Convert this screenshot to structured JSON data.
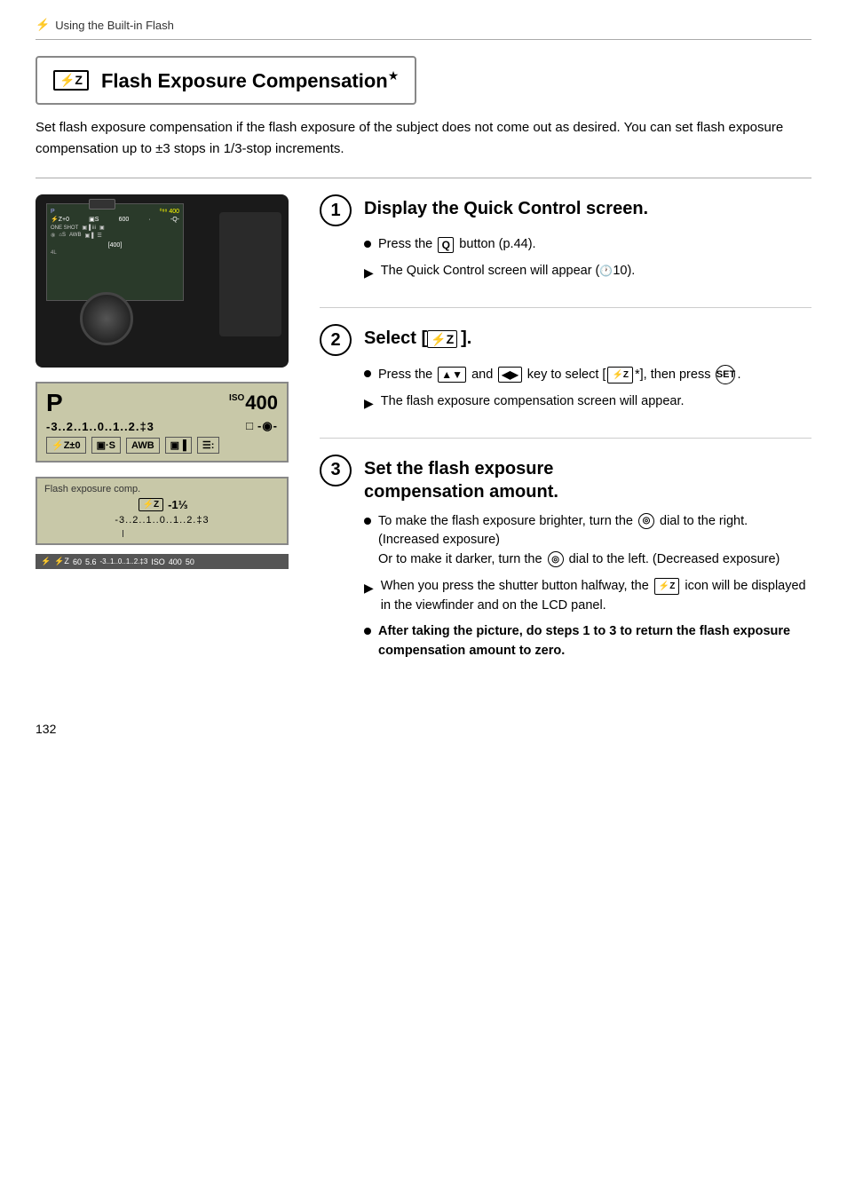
{
  "header": {
    "flash_icon": "⚡",
    "label": "Using the Built-in Flash"
  },
  "section": {
    "icon_label": "⚡Z",
    "title": "Flash Exposure Compensation",
    "star": "★",
    "intro": "Set flash exposure compensation if the flash exposure of the subject does not come out as desired. You can set flash exposure compensation up to ±3 stops in 1/3-stop increments."
  },
  "lcd": {
    "mode": "P",
    "iso_label": "ISO",
    "iso_value": "400",
    "scale": "-3..2..1..0..1..2.:3",
    "box1": "⚡Z±0",
    "box2": "▣·S",
    "box3": "AWB",
    "box4": "▣▐",
    "box5": "☰:"
  },
  "flash_comp_screen": {
    "title": "Flash exposure comp.",
    "value": "⚡Z -1⅓",
    "scale": "-3..2..1..0..1..2.:3",
    "status_items": [
      "⚡",
      "⚡Z",
      "60",
      "5.6",
      "-3..1..0..1..2.:3",
      "ISO",
      "400",
      "50"
    ]
  },
  "steps": [
    {
      "number": "1",
      "title": "Display the Quick Control screen.",
      "bullets": [
        {
          "type": "dot",
          "text": "Press the <Q> button (p.44)."
        },
        {
          "type": "arrow",
          "text": "The Quick Control screen will appear (🕐10)."
        }
      ]
    },
    {
      "number": "2",
      "title": "Select [⚡Z].",
      "bullets": [
        {
          "type": "dot",
          "text": "Press the <▲▼> and <◀▶> key to select [⚡Z *], then press <SET>."
        },
        {
          "type": "arrow",
          "text": "The flash exposure compensation screen will appear."
        }
      ]
    },
    {
      "number": "3",
      "title": "Set the flash exposure compensation amount.",
      "bullets": [
        {
          "type": "dot",
          "text": "To make the flash exposure brighter, turn the <◎> dial to the right. (Increased exposure) Or to make it darker, turn the <◎> dial to the left. (Decreased exposure)"
        },
        {
          "type": "arrow",
          "text": "When you press the shutter button halfway, the <⚡Z> icon will be displayed in the viewfinder and on the LCD panel."
        },
        {
          "type": "dot_bold",
          "text": "After taking the picture, do steps 1 to 3 to return the flash exposure compensation amount to zero."
        }
      ]
    }
  ],
  "page_number": "132"
}
